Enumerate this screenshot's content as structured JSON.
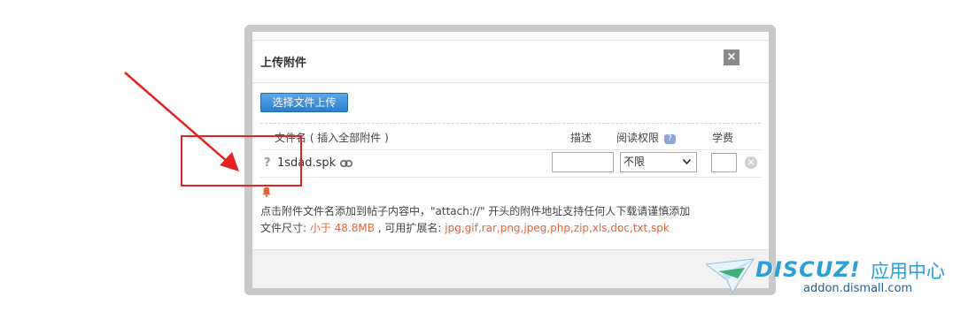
{
  "dialog": {
    "title": "上传附件",
    "close_glyph": "×",
    "upload_button_label": "选择文件上传"
  },
  "table": {
    "headers": {
      "filename": "文件名 ( 插入全部附件 )",
      "description": "描述",
      "permission": "阅读权限",
      "permission_help": "?",
      "fee": "学费"
    },
    "rows": [
      {
        "status_glyph": "?",
        "filename": "1sdad.spk",
        "description": "",
        "permission": "不限",
        "fee": "",
        "delete_glyph": "×"
      }
    ]
  },
  "tips": {
    "line1": "点击附件文件名添加到帖子内容中，\"attach://\" 开头的附件地址支持任何人下载请谨慎添加",
    "line2_prefix": "文件尺寸: ",
    "size_limit": "小于 48.8MB",
    "line2_mid": " , 可用扩展名: ",
    "extensions": "jpg,gif,rar,png,jpeg,php,zip,xls,doc,txt,spk"
  },
  "watermark": {
    "brand": "DISCUZ!",
    "label": "应用中心",
    "url": "addon.dismall.com"
  },
  "colors": {
    "accent_blue": "#2b7fd0",
    "highlight_orange": "#e8623a",
    "annotation_red": "#e52222",
    "watermark_blue": "#2a9fd6"
  },
  "icons": {
    "link": "link-icon",
    "bell": "bell-icon",
    "close": "close-icon",
    "delete": "delete-icon",
    "dropdown": "chevron-down-icon"
  }
}
